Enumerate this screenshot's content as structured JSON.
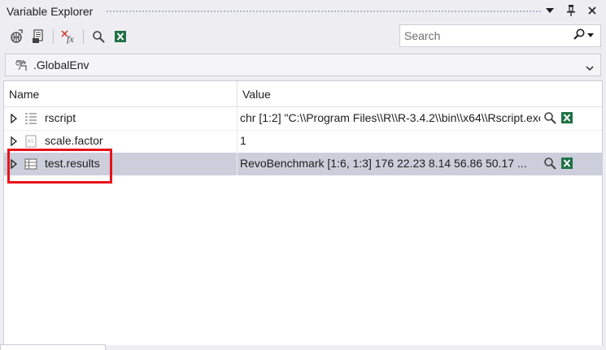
{
  "panel": {
    "title": "Variable Explorer"
  },
  "search": {
    "placeholder": "Search"
  },
  "environment": {
    "selected": ".GlobalEnv"
  },
  "grid": {
    "columns": [
      "Name",
      "Value"
    ],
    "rows": [
      {
        "name": "rscript",
        "value": "chr [1:2] \"C:\\\\Program Files\\\\R\\\\R-3.4.2\\\\bin\\\\x64\\\\Rscript.exe\"",
        "icon": "list-icon",
        "selected": false
      },
      {
        "name": "scale.factor",
        "value": "1",
        "icon": "numeric-icon",
        "selected": false
      },
      {
        "name": "test.results",
        "value": "RevoBenchmark [1:6, 1:3] 176 22.23 8.14 56.86 50.17 ...",
        "icon": "table-icon",
        "selected": true
      }
    ]
  },
  "colors": {
    "accent_excel": "#1e7145",
    "selection": "#cccedb",
    "highlight": "#e8121a"
  }
}
